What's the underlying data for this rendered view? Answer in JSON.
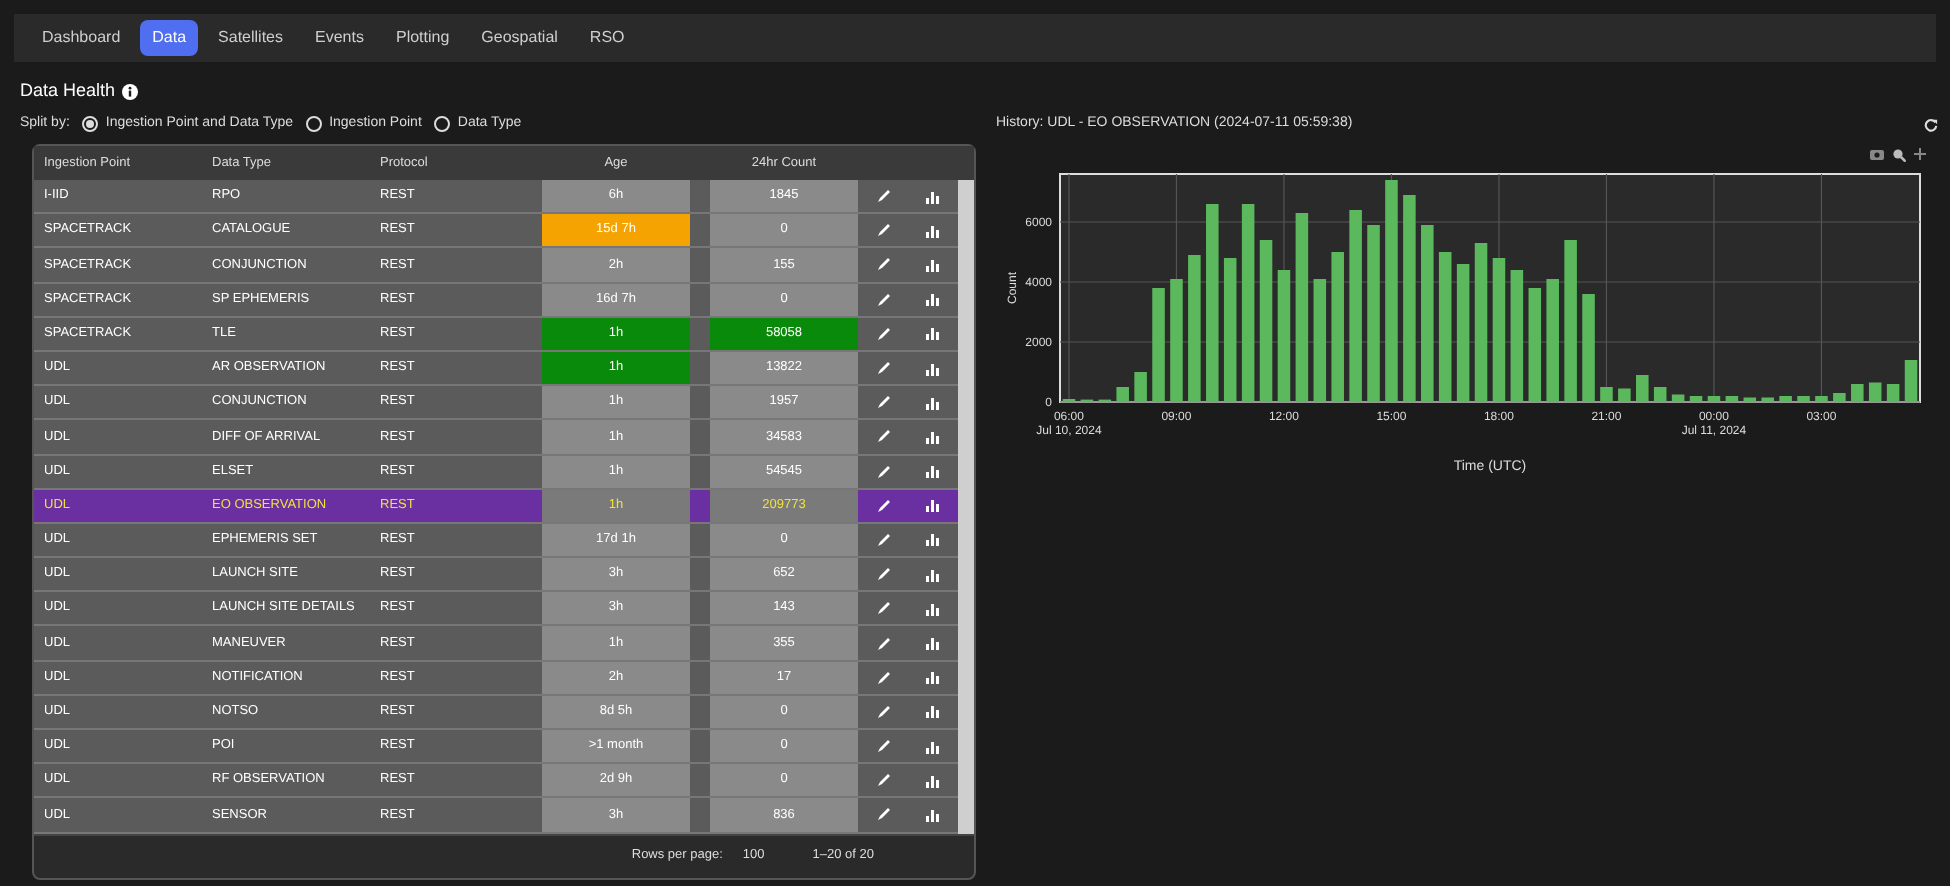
{
  "nav": {
    "tabs": [
      {
        "label": "Dashboard",
        "selected": false
      },
      {
        "label": "Data",
        "selected": true
      },
      {
        "label": "Satellites",
        "selected": false
      },
      {
        "label": "Events",
        "selected": false
      },
      {
        "label": "Plotting",
        "selected": false
      },
      {
        "label": "Geospatial",
        "selected": false
      },
      {
        "label": "RSO",
        "selected": false
      }
    ]
  },
  "health": {
    "title": "Data Health",
    "split_label": "Split by:",
    "split_options": [
      {
        "label": "Ingestion Point and Data Type",
        "selected": true
      },
      {
        "label": "Ingestion Point",
        "selected": false
      },
      {
        "label": "Data Type",
        "selected": false
      }
    ]
  },
  "table": {
    "columns": [
      "Ingestion Point",
      "Data Type",
      "Protocol",
      "Age",
      "24hr Count"
    ],
    "rows": [
      {
        "ingestion_point": "I-IID",
        "data_type": "RPO",
        "protocol": "REST",
        "age": {
          "text": "6h"
        },
        "count": {
          "text": "1845"
        },
        "selected": false
      },
      {
        "ingestion_point": "SPACETRACK",
        "data_type": "CATALOGUE",
        "protocol": "REST",
        "age": {
          "text": "15d 7h",
          "color": "#f5a300"
        },
        "count": {
          "text": "0"
        },
        "selected": false
      },
      {
        "ingestion_point": "SPACETRACK",
        "data_type": "CONJUNCTION",
        "protocol": "REST",
        "age": {
          "text": "2h"
        },
        "count": {
          "text": "155"
        },
        "selected": false
      },
      {
        "ingestion_point": "SPACETRACK",
        "data_type": "SP EPHEMERIS",
        "protocol": "REST",
        "age": {
          "text": "16d 7h"
        },
        "count": {
          "text": "0"
        },
        "selected": false
      },
      {
        "ingestion_point": "SPACETRACK",
        "data_type": "TLE",
        "protocol": "REST",
        "age": {
          "text": "1h",
          "color": "#0a8a0a"
        },
        "count": {
          "text": "58058",
          "color": "#0a8a0a"
        },
        "selected": false
      },
      {
        "ingestion_point": "UDL",
        "data_type": "AR OBSERVATION",
        "protocol": "REST",
        "age": {
          "text": "1h",
          "color": "#0a8a0a"
        },
        "count": {
          "text": "13822"
        },
        "selected": false
      },
      {
        "ingestion_point": "UDL",
        "data_type": "CONJUNCTION",
        "protocol": "REST",
        "age": {
          "text": "1h"
        },
        "count": {
          "text": "1957"
        },
        "selected": false
      },
      {
        "ingestion_point": "UDL",
        "data_type": "DIFF OF ARRIVAL",
        "protocol": "REST",
        "age": {
          "text": "1h"
        },
        "count": {
          "text": "34583"
        },
        "selected": false
      },
      {
        "ingestion_point": "UDL",
        "data_type": "ELSET",
        "protocol": "REST",
        "age": {
          "text": "1h"
        },
        "count": {
          "text": "54545"
        },
        "selected": false
      },
      {
        "ingestion_point": "UDL",
        "data_type": "EO OBSERVATION",
        "protocol": "REST",
        "age": {
          "text": "1h"
        },
        "count": {
          "text": "209773"
        },
        "selected": true
      },
      {
        "ingestion_point": "UDL",
        "data_type": "EPHEMERIS SET",
        "protocol": "REST",
        "age": {
          "text": "17d 1h"
        },
        "count": {
          "text": "0"
        },
        "selected": false
      },
      {
        "ingestion_point": "UDL",
        "data_type": "LAUNCH SITE",
        "protocol": "REST",
        "age": {
          "text": "3h"
        },
        "count": {
          "text": "652"
        },
        "selected": false
      },
      {
        "ingestion_point": "UDL",
        "data_type": "LAUNCH SITE DETAILS",
        "protocol": "REST",
        "age": {
          "text": "3h"
        },
        "count": {
          "text": "143"
        },
        "selected": false
      },
      {
        "ingestion_point": "UDL",
        "data_type": "MANEUVER",
        "protocol": "REST",
        "age": {
          "text": "1h"
        },
        "count": {
          "text": "355"
        },
        "selected": false
      },
      {
        "ingestion_point": "UDL",
        "data_type": "NOTIFICATION",
        "protocol": "REST",
        "age": {
          "text": "2h"
        },
        "count": {
          "text": "17"
        },
        "selected": false
      },
      {
        "ingestion_point": "UDL",
        "data_type": "NOTSO",
        "protocol": "REST",
        "age": {
          "text": "8d 5h"
        },
        "count": {
          "text": "0"
        },
        "selected": false
      },
      {
        "ingestion_point": "UDL",
        "data_type": "POI",
        "protocol": "REST",
        "age": {
          "text": ">1 month"
        },
        "count": {
          "text": "0"
        },
        "selected": false
      },
      {
        "ingestion_point": "UDL",
        "data_type": "RF OBSERVATION",
        "protocol": "REST",
        "age": {
          "text": "2d 9h"
        },
        "count": {
          "text": "0"
        },
        "selected": false
      },
      {
        "ingestion_point": "UDL",
        "data_type": "SENSOR",
        "protocol": "REST",
        "age": {
          "text": "3h"
        },
        "count": {
          "text": "836"
        },
        "selected": false
      }
    ],
    "footer": {
      "rows_per_page_label": "Rows per page:",
      "rows_per_page": "100",
      "range": "1–20 of 20"
    }
  },
  "history": {
    "title": "History: UDL - EO OBSERVATION (2024-07-11 05:59:38)",
    "chart_data": {
      "type": "bar",
      "xlabel": "Time (UTC)",
      "ylabel": "Count",
      "categories": [
        "06:00\nJul 10, 2024",
        null,
        null,
        null,
        null,
        null,
        "09:00",
        null,
        null,
        null,
        null,
        null,
        "12:00",
        null,
        null,
        null,
        null,
        null,
        "15:00",
        null,
        null,
        null,
        null,
        null,
        "18:00",
        null,
        null,
        null,
        null,
        null,
        "21:00",
        null,
        null,
        null,
        null,
        null,
        "00:00\nJul 11, 2024",
        null,
        null,
        null,
        null,
        null,
        "03:00",
        null,
        null,
        null,
        null,
        null
      ],
      "grid": true,
      "series": [
        {
          "color": "#5cb85c",
          "values": [
            100,
            80,
            80,
            500,
            1000,
            3800,
            4100,
            4900,
            6600,
            4800,
            6600,
            5400,
            4400,
            6300,
            4100,
            5000,
            6400,
            5900,
            7400,
            6900,
            5900,
            5000,
            4600,
            5300,
            4800,
            4400,
            3800,
            4100,
            5400,
            3600,
            500,
            450,
            900,
            500,
            250,
            200,
            200,
            200,
            150,
            150,
            200,
            200,
            200,
            300,
            600,
            650,
            600,
            1400
          ]
        }
      ],
      "ylim": [
        0,
        7600
      ],
      "yticks": [
        0,
        2000,
        4000,
        6000
      ]
    }
  }
}
